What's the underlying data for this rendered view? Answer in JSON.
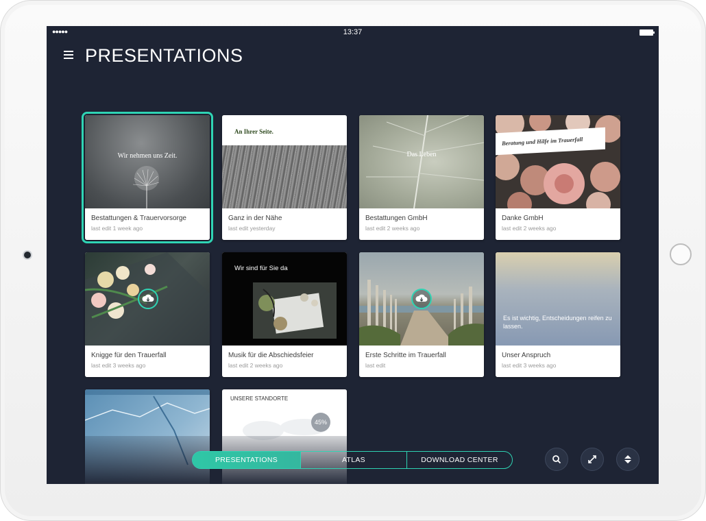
{
  "status_bar": {
    "time": "13:37",
    "signal": "●●●●●"
  },
  "header": {
    "title": "PRESENTATIONS"
  },
  "cards": [
    {
      "name": "Bestattungen & Trauervorsorge",
      "edit": "last edit 1 week ago",
      "thumb_title": "Wir nehmen uns Zeit.",
      "selected": true
    },
    {
      "name": "Ganz in der Nähe",
      "edit": "last edit yesterday",
      "thumb_title": "An Ihrer Seite."
    },
    {
      "name": "Bestattungen GmbH",
      "edit": "last edit 2 weeks ago",
      "thumb_title": "Das Leben"
    },
    {
      "name": "Danke GmbH",
      "edit": "last edit 2 weeks ago",
      "thumb_title": "Beratung und Hilfe im Trauerfall"
    },
    {
      "name": "Knigge für den Trauerfall",
      "edit": "last edit 3 weeks ago",
      "thumb_title": ""
    },
    {
      "name": "Musik für die Abschiedsfeier",
      "edit": "last edit 2 weeks ago",
      "thumb_title": "Wir sind für Sie da"
    },
    {
      "name": "Erste Schritte im Trauerfall",
      "edit": "last edit",
      "thumb_title": ""
    },
    {
      "name": "Unser Anspruch",
      "edit": "last edit 3 weeks ago",
      "thumb_title": "Es ist wichtig, Entscheidungen reifen zu lassen."
    },
    {
      "name": "",
      "edit": "",
      "thumb_title": ""
    },
    {
      "name": "",
      "edit": "",
      "thumb_title": "UNSERE STANDORTE",
      "progress": "45%"
    }
  ],
  "nav": {
    "tabs": [
      "PRESENTATIONS",
      "ATLAS",
      "DOWNLOAD CENTER"
    ],
    "active": "PRESENTATIONS"
  },
  "colors": {
    "accent": "#2fd4b4",
    "background": "#1e2434"
  }
}
